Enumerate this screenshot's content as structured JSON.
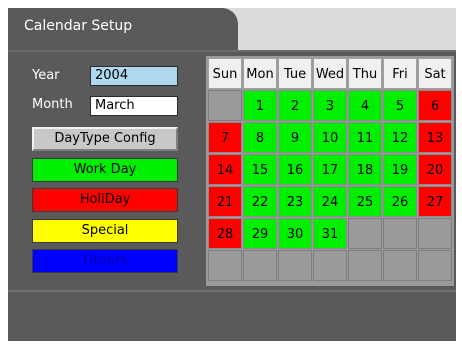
{
  "title": "Calendar Setup",
  "year": {
    "label": "Year",
    "value": "2004"
  },
  "month": {
    "label": "Month",
    "value": "March"
  },
  "buttons": {
    "config": "DayType Config",
    "work": "Work Day",
    "holiday": "HoliDay",
    "special": "Special",
    "others": "Others"
  },
  "colors": {
    "work": "#00ee00",
    "holiday": "#ff0000",
    "special": "#ffff00",
    "others": "#0000ff",
    "empty": "#9a9a9a"
  },
  "weekdays": [
    "Sun",
    "Mon",
    "Tue",
    "Wed",
    "Thu",
    "Fri",
    "Sat"
  ],
  "weeks": [
    [
      {
        "d": "",
        "t": "empty"
      },
      {
        "d": "1",
        "t": "work"
      },
      {
        "d": "2",
        "t": "work"
      },
      {
        "d": "3",
        "t": "work"
      },
      {
        "d": "4",
        "t": "work"
      },
      {
        "d": "5",
        "t": "work"
      },
      {
        "d": "6",
        "t": "holiday"
      }
    ],
    [
      {
        "d": "7",
        "t": "holiday"
      },
      {
        "d": "8",
        "t": "work"
      },
      {
        "d": "9",
        "t": "work"
      },
      {
        "d": "10",
        "t": "work"
      },
      {
        "d": "11",
        "t": "work"
      },
      {
        "d": "12",
        "t": "work"
      },
      {
        "d": "13",
        "t": "holiday"
      }
    ],
    [
      {
        "d": "14",
        "t": "holiday"
      },
      {
        "d": "15",
        "t": "work"
      },
      {
        "d": "16",
        "t": "work"
      },
      {
        "d": "17",
        "t": "work"
      },
      {
        "d": "18",
        "t": "work"
      },
      {
        "d": "19",
        "t": "work"
      },
      {
        "d": "20",
        "t": "holiday"
      }
    ],
    [
      {
        "d": "21",
        "t": "holiday"
      },
      {
        "d": "22",
        "t": "work"
      },
      {
        "d": "23",
        "t": "work"
      },
      {
        "d": "24",
        "t": "work"
      },
      {
        "d": "25",
        "t": "work"
      },
      {
        "d": "26",
        "t": "work"
      },
      {
        "d": "27",
        "t": "holiday"
      }
    ],
    [
      {
        "d": "28",
        "t": "holiday"
      },
      {
        "d": "29",
        "t": "work"
      },
      {
        "d": "30",
        "t": "work"
      },
      {
        "d": "31",
        "t": "work"
      },
      {
        "d": "",
        "t": "empty"
      },
      {
        "d": "",
        "t": "empty"
      },
      {
        "d": "",
        "t": "empty"
      }
    ],
    [
      {
        "d": "",
        "t": "empty"
      },
      {
        "d": "",
        "t": "empty"
      },
      {
        "d": "",
        "t": "empty"
      },
      {
        "d": "",
        "t": "empty"
      },
      {
        "d": "",
        "t": "empty"
      },
      {
        "d": "",
        "t": "empty"
      },
      {
        "d": "",
        "t": "empty"
      }
    ]
  ]
}
